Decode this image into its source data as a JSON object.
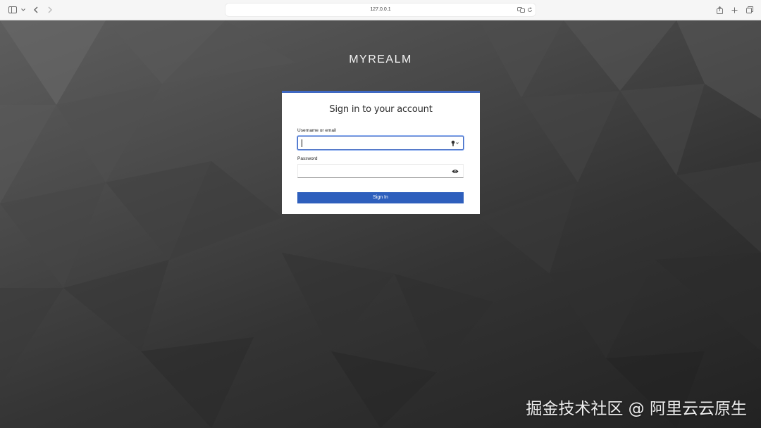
{
  "browser": {
    "url": "127.0.0.1",
    "icons": {
      "sidebar": "sidebar-icon",
      "sidebar_menu": "chevron-down-icon",
      "back": "chevron-left-icon",
      "forward": "chevron-right-icon",
      "translate": "translate-icon",
      "reload": "reload-icon",
      "share": "share-icon",
      "new_tab": "plus-icon",
      "tabs": "tabs-overview-icon"
    }
  },
  "realm": {
    "title": "MYREALM"
  },
  "login": {
    "heading": "Sign in to your account",
    "username": {
      "label": "Username or email",
      "value": "",
      "icon": "password-autofill-key-icon"
    },
    "password": {
      "label": "Password",
      "value": "",
      "icon": "eye-icon"
    },
    "submit_label": "Sign In"
  },
  "watermark": {
    "text": "掘金技术社区 @ 阿里云云原生"
  },
  "colors": {
    "accent": "#2e5fbd",
    "card_border": "#3f68c2",
    "background_dark": "#222222"
  }
}
